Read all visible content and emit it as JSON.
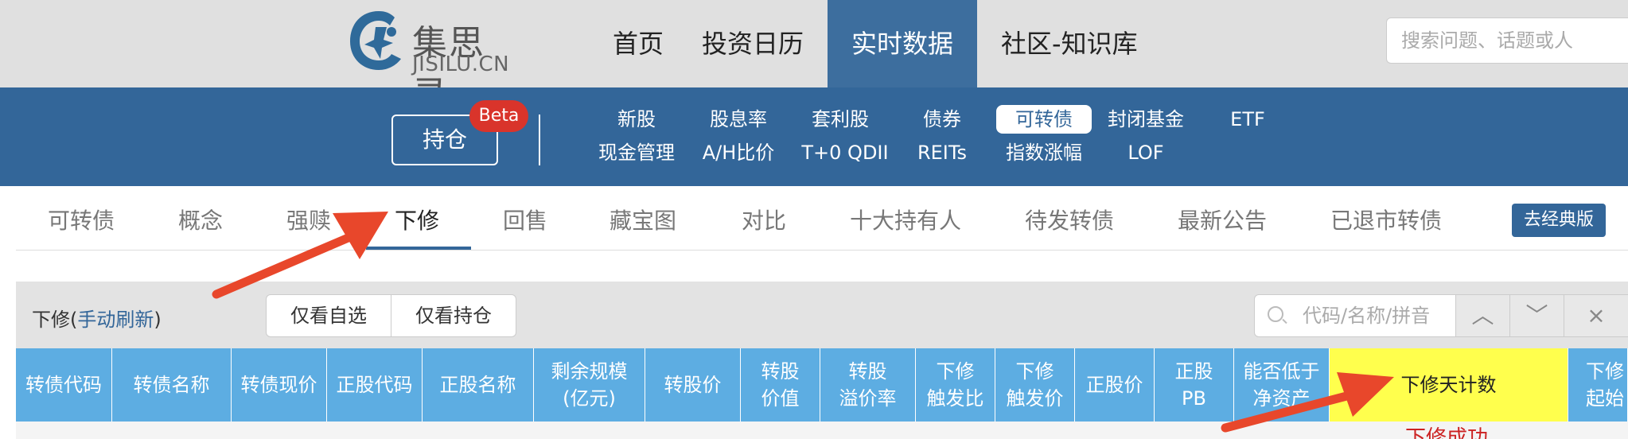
{
  "header": {
    "logo_cn": "集思录",
    "logo_en": "JISILU.CN",
    "nav": [
      {
        "label": "首页"
      },
      {
        "label": "投资日历"
      },
      {
        "label": "实时数据"
      },
      {
        "label": "社区-知识库"
      }
    ],
    "search_placeholder": "搜索问题、话题或人"
  },
  "blue_bar": {
    "hold_label": "持仓",
    "beta_label": "Beta",
    "links_row1": [
      "新股",
      "股息率",
      "套利股",
      "债券",
      "可转债",
      "封闭基金",
      "ETF"
    ],
    "links_row2": [
      "现金管理",
      "A/H比价",
      "T+0 QDII",
      "REITs",
      "指数涨幅",
      "LOF"
    ],
    "selected": "可转债"
  },
  "subtabs": {
    "items": [
      "可转债",
      "概念",
      "强赎",
      "下修",
      "回售",
      "藏宝图",
      "对比",
      "十大持有人",
      "待发转债",
      "最新公告",
      "已退市转债"
    ],
    "active": "下修",
    "classic_label": "去经典版"
  },
  "panel": {
    "title_prefix": "下修(",
    "refresh_link": "手动刷新",
    "title_suffix": ")",
    "filter_watchlist": "仅看自选",
    "filter_holdings": "仅看持仓",
    "search_placeholder": "代码/名称/拼音",
    "up": "︿",
    "down": "﹀",
    "close": "×"
  },
  "table": {
    "headers": [
      "转债代码",
      "转债名称",
      "转债现价",
      "正股代码",
      "正股名称",
      "剩余规模\n(亿元)",
      "转股价",
      "转股\n价值",
      "转股\n溢价率",
      "下修\n触发比",
      "下修\n触发价",
      "正股价",
      "正股\nPB",
      "能否低于\n净资产",
      "下修天计数",
      "下修\n起始"
    ],
    "highlighted_header": "下修天计数",
    "row_status": "下修成功"
  },
  "colors": {
    "blue_bar": "#336699",
    "header_cell": "#5dade2",
    "highlight": "#ffff4d",
    "beta": "#d9342b",
    "arrow": "#e8472b"
  }
}
